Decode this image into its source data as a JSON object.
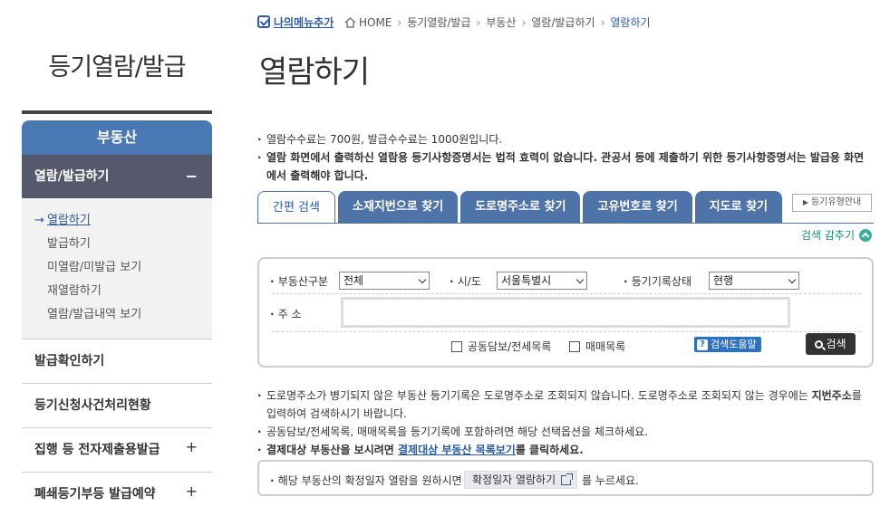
{
  "sidebar": {
    "title": "등기열람/발급",
    "category": "부동산",
    "submenu": "열람/발급하기",
    "submenu_toggle": "−",
    "items": [
      {
        "label": "열람하기",
        "active": true
      },
      {
        "label": "발급하기"
      },
      {
        "label": "미열람/미발급 보기"
      },
      {
        "label": "재열람하기"
      },
      {
        "label": "열람/발급내역 보기"
      }
    ],
    "active_marker": "→",
    "menus": [
      {
        "label": "발급확인하기",
        "toggle": ""
      },
      {
        "label": "등기신청사건처리현황",
        "toggle": ""
      },
      {
        "label": "집행 등 전자제출용발급",
        "toggle": "+"
      },
      {
        "label": "폐쇄등기부등 발급예약",
        "toggle": "+"
      }
    ]
  },
  "header": {
    "my_menu": "나의메뉴추가",
    "breadcrumb": [
      "HOME",
      "등기열람/발급",
      "부동산",
      "열람/발급하기",
      "열람하기"
    ],
    "separator": "›",
    "page_title": "열람하기"
  },
  "notes": {
    "n1": "열람수수료는 700원, 발급수수료는 1000원입니다.",
    "n2": "열람 화면에서 출력하신 열람용 등기사항증명서는 법적 효력이 없습니다. 관공서 등에 제출하기 위한 등기사항증명서는 발급용 화면에서 출력해야 합니다."
  },
  "tabs": [
    "간편 검색",
    "소재지번으로 찾기",
    "도로명주소로 찾기",
    "고유번호로 찾기",
    "지도로 찾기"
  ],
  "guide_button": "등기유형안내",
  "collapse_label": "검색 감추기",
  "search": {
    "type_label": "부동산구분",
    "type_value": "전체",
    "region_label": "시/도",
    "region_value": "서울특별시",
    "status_label": "등기기록상태",
    "status_value": "현행",
    "address_label": "주 소",
    "address_value": "",
    "cb1": "공동담보/전세목록",
    "cb2": "매매목록",
    "help": "검색도움말",
    "search_btn": "검색"
  },
  "bottom_notes": {
    "b1a": "도로명주소가 병기되지 않은 부동산 등기기록은 도로명주소로 조회되지 않습니다. 도로명주소로 조회되지 않는 경우에는 ",
    "b1b": "지번주소",
    "b1c": "를 입력하여 검색하시기 바랍니다.",
    "b2": "공동담보/전세목록, 매매목록을 등기기록에 포함하려면 해당 선택옵션을 체크하세요.",
    "b3a": "결제대상 부동산을 보시려면 ",
    "b3link": "결제대상 부동산 목록보기",
    "b3b": "를 클릭하세요."
  },
  "info": {
    "t1": "해당 부동산의 확정일자 열람을 원하시면",
    "btn": "확정일자 열람하기",
    "t2": "를 누르세요."
  }
}
